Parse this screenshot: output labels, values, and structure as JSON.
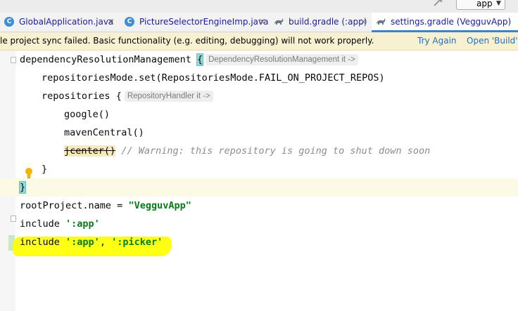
{
  "toolbar": {
    "run_config": "app",
    "dropdown_glyph": "▼"
  },
  "tabs": [
    {
      "label": "GlobalApplication.java",
      "icon": "java-class-icon",
      "icon_letter": "C",
      "active": false
    },
    {
      "label": "PictureSelectorEngineImp.java",
      "icon": "java-class-icon",
      "icon_letter": "C",
      "active": false
    },
    {
      "label": "build.gradle (:app)",
      "icon": "gradle-icon",
      "active": false
    },
    {
      "label": "settings.gradle (VegguvApp)",
      "icon": "gradle-icon",
      "active": true
    }
  ],
  "tab_close_glyph": "×",
  "notification": {
    "message": "le project sync failed. Basic functionality (e.g. editing, debugging) will not work properly.",
    "actions": [
      "Try Again",
      "Open 'Build' Vi"
    ]
  },
  "code": {
    "l1_keyword": "dependencyResolutionManagement",
    "l1_brace": "{",
    "l1_hint": "DependencyResolutionManagement it ->",
    "l2": "repositoriesMode.set(RepositoriesMode.FAIL_ON_PROJECT_REPOS)",
    "l3_keyword": "repositories",
    "l3_brace": "{",
    "l3_hint": "RepositoryHandler it ->",
    "l4": "google()",
    "l5": "mavenCentral()",
    "l6_deprecated": "jcenter",
    "l6_parens": "()",
    "l6_comment": "// Warning: this repository is going to shut down soon",
    "l7": "}",
    "l8": "}",
    "l9_prefix": "rootProject.name = ",
    "l9_string": "\"VegguvApp\"",
    "l10_prefix": "include ",
    "l10_string": "':app'",
    "l11_prefix": "include ",
    "l11_string1": "':app'",
    "l11_sep": ", ",
    "l11_string2": "':picker'"
  },
  "colors": {
    "highlighter": "#ffff00",
    "string": "#067d17",
    "comment": "#8c8c8c",
    "link": "#2470b3",
    "notification_bg": "#f7f1d2",
    "active_tab_underline": "#4083c9"
  }
}
